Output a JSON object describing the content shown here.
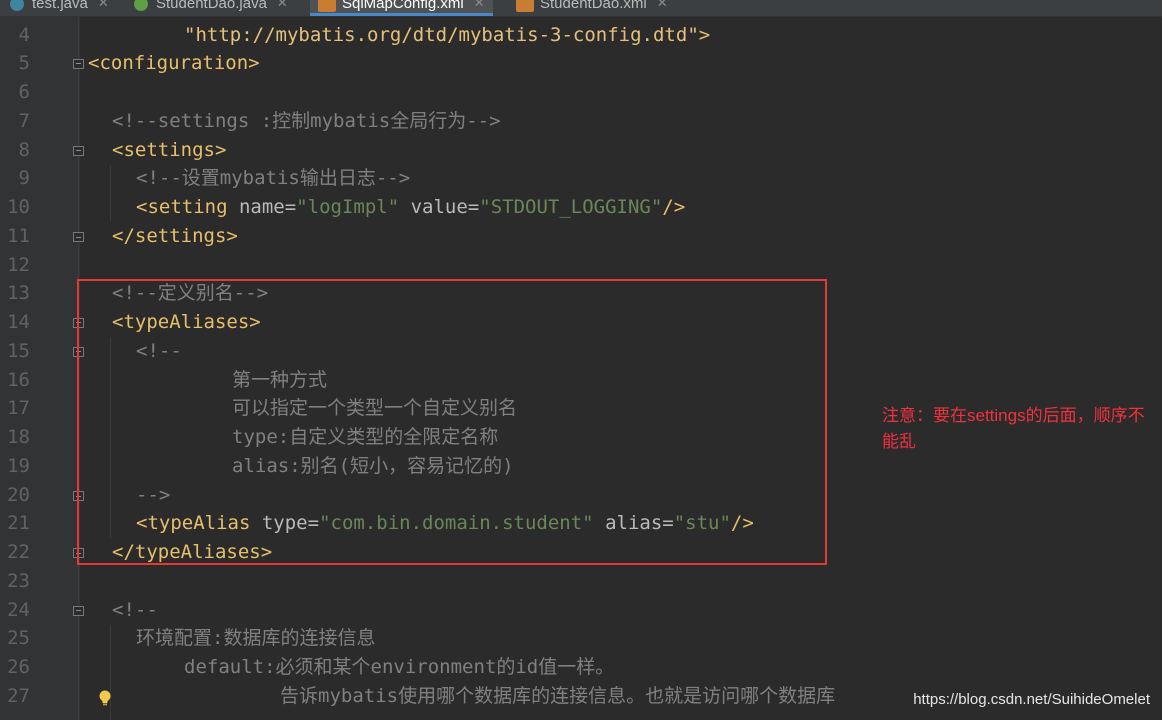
{
  "tabs": [
    {
      "label": "test.java",
      "icon": "java-class-icon"
    },
    {
      "label": "StudentDao.java",
      "icon": "java-interface-icon"
    },
    {
      "label": "SqlMapConfig.xml",
      "icon": "xml-file-icon",
      "active": true
    },
    {
      "label": "StudentDao.xml",
      "icon": "xml-file-icon"
    }
  ],
  "line_numbers": [
    "4",
    "5",
    "6",
    "7",
    "8",
    "9",
    "10",
    "11",
    "12",
    "13",
    "14",
    "15",
    "16",
    "17",
    "18",
    "19",
    "20",
    "21",
    "22",
    "23",
    "24",
    "25",
    "26",
    "27"
  ],
  "code": {
    "l4_url": "\"http://mybatis.org/dtd/mybatis-3-config.dtd\"",
    "l4_end": ">",
    "l5": "<configuration>",
    "l7": "<!--settings :控制mybatis全局行为-->",
    "l8": "<settings>",
    "l9": "<!--设置mybatis输出日志-->",
    "l10_open": "<setting",
    "l10_name_attr": "name",
    "l10_name_val": "\"logImpl\"",
    "l10_value_attr": "value",
    "l10_value_val": "\"STDOUT_LOGGING\"",
    "l10_close": "/>",
    "l11": "</settings>",
    "l13": "<!--定义别名-->",
    "l14": "<typeAliases>",
    "l15": "<!--",
    "l16": "第一种方式",
    "l17": "可以指定一个类型一个自定义别名",
    "l18": "type:自定义类型的全限定名称",
    "l19": "alias:别名(短小，容易记忆的)",
    "l20": "-->",
    "l21_open": "<typeAlias",
    "l21_type_attr": "type",
    "l21_type_val": "\"com.bin.domain.student\"",
    "l21_alias_attr": "alias",
    "l21_alias_val": "\"stu\"",
    "l21_close": "/>",
    "l22": "</typeAliases>",
    "l24": "<!--",
    "l25": "环境配置:数据库的连接信息",
    "l26": "default:必须和某个environment的id值一样。",
    "l27": "告诉mybatis使用哪个数据库的连接信息。也就是访问哪个数据库"
  },
  "annotation_note": "注意：要在settings的后面，顺序不能乱",
  "watermark": "https://blog.csdn.net/SuihideOmelet",
  "colors": {
    "background": "#2b2b2b",
    "tag": "#e8bf6a",
    "attribute": "#bababa",
    "string": "#6a8759",
    "comment": "#808080",
    "highlight_box": "#e53935",
    "note": "#f0323c"
  }
}
